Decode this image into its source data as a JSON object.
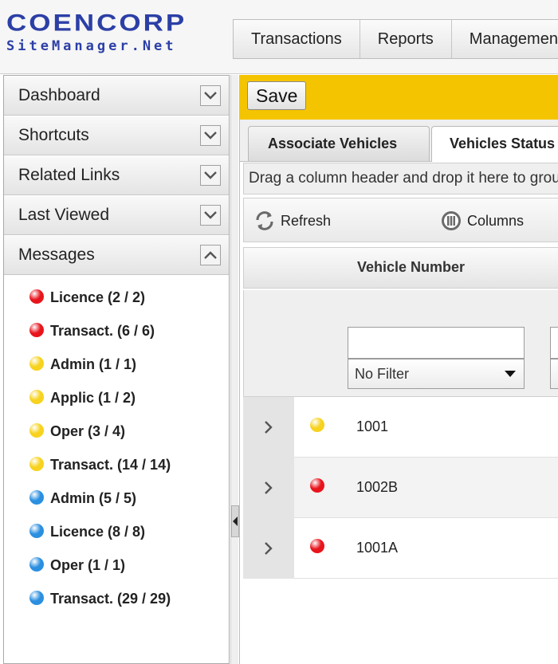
{
  "header": {
    "logo_main": "COENCORP",
    "logo_sub": "SiteManager.Net",
    "nav": [
      "Transactions",
      "Reports",
      "Management"
    ]
  },
  "sidebar": {
    "sections": [
      {
        "label": "Dashboard",
        "expanded": false
      },
      {
        "label": "Shortcuts",
        "expanded": false
      },
      {
        "label": "Related Links",
        "expanded": false
      },
      {
        "label": "Last Viewed",
        "expanded": false
      },
      {
        "label": "Messages",
        "expanded": true
      }
    ],
    "messages": [
      {
        "label": "Licence (2 / 2)",
        "status": "red"
      },
      {
        "label": "Transact. (6 / 6)",
        "status": "red"
      },
      {
        "label": "Admin (1 / 1)",
        "status": "yellow"
      },
      {
        "label": "Applic (1 / 2)",
        "status": "yellow"
      },
      {
        "label": "Oper (3 / 4)",
        "status": "yellow"
      },
      {
        "label": "Transact. (14 / 14)",
        "status": "yellow"
      },
      {
        "label": "Admin (5 / 5)",
        "status": "blue"
      },
      {
        "label": "Licence (8 / 8)",
        "status": "blue"
      },
      {
        "label": "Oper (1 / 1)",
        "status": "blue"
      },
      {
        "label": "Transact. (29 / 29)",
        "status": "blue"
      }
    ]
  },
  "main": {
    "save_label": "Save",
    "tabs": [
      "Associate Vehicles",
      "Vehicles Status"
    ],
    "grouping_hint": "Drag a column header and drop it here to group by that column",
    "toolbar": {
      "refresh": "Refresh",
      "columns": "Columns"
    },
    "grid": {
      "column_header": "Vehicle Number",
      "filter_value": "",
      "filter_option": "No Filter",
      "rows": [
        {
          "status": "yellow",
          "number": "1001"
        },
        {
          "status": "red",
          "number": "1002B"
        },
        {
          "status": "red",
          "number": "1001A"
        }
      ]
    }
  },
  "colors": {
    "brand": "#2c3fa6",
    "toolbar_yellow": "#f5c400",
    "red": "#e8141c",
    "yellow": "#f7d21e",
    "blue": "#2b8fe0"
  }
}
